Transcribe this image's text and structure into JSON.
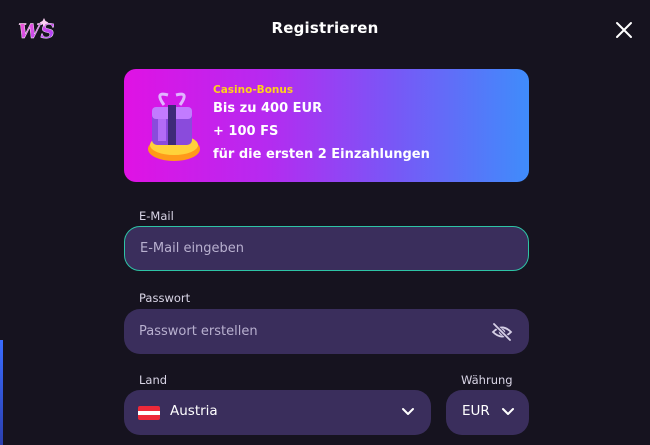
{
  "header": {
    "logo_text": "WS",
    "title": "Registrieren",
    "close_icon": "close-icon"
  },
  "banner": {
    "tag": "Casino-Bonus",
    "line1": "Bis zu 400 EUR",
    "line2": "+ 100 FS",
    "line3": "für die ersten 2 Einzahlungen",
    "icon": "gift-box-icon"
  },
  "form": {
    "email": {
      "label": "E-Mail",
      "placeholder": "E-Mail eingeben"
    },
    "password": {
      "label": "Passwort",
      "placeholder": "Passwort erstellen",
      "toggle_icon": "eye-slash-icon"
    },
    "country": {
      "label": "Land",
      "value": "Austria",
      "flag": "austria-flag-icon"
    },
    "currency": {
      "label": "Währung",
      "value": "EUR"
    }
  },
  "colors": {
    "background": "#16131f",
    "field": "#3a2e5c",
    "focus_border": "#2ec4a6",
    "bonus_tag": "#ffd21a",
    "banner_start": "#e012e4",
    "banner_end": "#3f8cfb"
  }
}
